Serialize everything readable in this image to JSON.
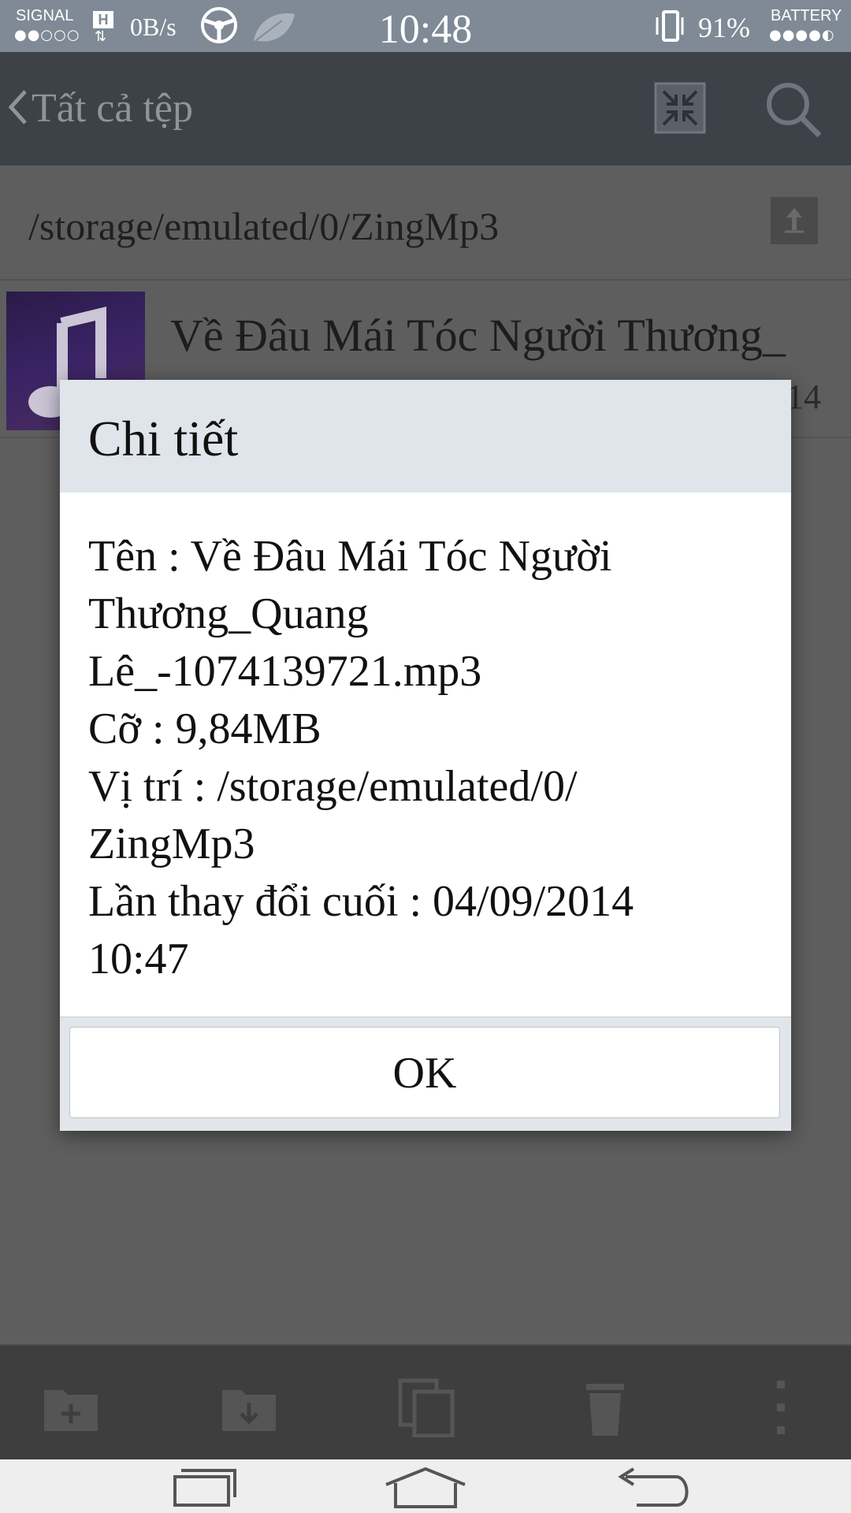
{
  "status_bar": {
    "signal_label": "SIGNAL",
    "signal_dots": "●●○○○",
    "network_type": "H",
    "data_arrows": "⇅",
    "data_rate": "0B/s",
    "time": "10:48",
    "battery_percent": "91%",
    "battery_label": "BATTERY",
    "battery_dots": "●●●●◐"
  },
  "app_bar": {
    "title": "Tất cả tệp",
    "icons": [
      "chevron-left-icon",
      "collapse-icon",
      "search-icon"
    ]
  },
  "path_bar": {
    "path": "/storage/emulated/0/ZingMp3",
    "icons": [
      "up-arrow-icon"
    ]
  },
  "file_list": [
    {
      "name": "Về Đâu Mái Tóc Người Thương_",
      "date_fragment": "14",
      "icon": "music-note-icon"
    }
  ],
  "dialog": {
    "title": "Chi tiết",
    "lines": [
      "Tên : Về Đâu Mái Tóc Người",
      "Thương_Quang",
      "Lê_-1074139721.mp3",
      "Cỡ : 9,84MB",
      "Vị trí : /storage/emulated/0/",
      "ZingMp3",
      "Lần thay đổi cuối : 04/09/2014",
      "10:47"
    ],
    "ok_label": "OK"
  },
  "toolbar": {
    "icons": [
      "new-folder-icon",
      "move-to-folder-icon",
      "copy-icon",
      "delete-icon",
      "overflow-menu-icon"
    ]
  },
  "nav_bar": {
    "icons": [
      "recent-apps-icon",
      "home-icon",
      "back-icon"
    ]
  },
  "colors": {
    "status_bar": "#7f8a96",
    "dialog_header": "#dfe5ea",
    "dim_overlay": "#5e5e5e"
  }
}
